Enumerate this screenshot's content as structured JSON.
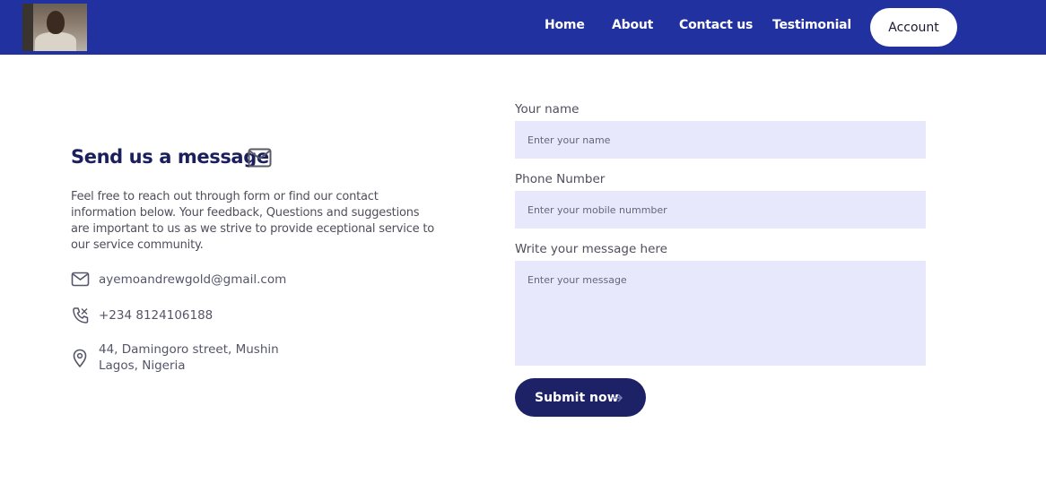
{
  "nav": {
    "links": [
      {
        "label": "Home"
      },
      {
        "label": "About"
      },
      {
        "label": "Contact us"
      },
      {
        "label": "Testimonial"
      }
    ],
    "account_label": "Account"
  },
  "contact": {
    "title": "Send us a message",
    "intro": "Feel free to reach out through form or find our contact information below. Your feedback, Questions and suggestions are important to us as we strive to provide eceptional service to our service community.",
    "email": "ayemoandrewgold@gmail.com",
    "phone": "+234 8124106188",
    "address_line1": "44, Damingoro street, Mushin",
    "address_line2": "Lagos, Nigeria"
  },
  "form": {
    "name_label": "Your name",
    "name_placeholder": "Enter your name",
    "phone_label": "Phone Number",
    "phone_placeholder": "Enter your mobile nummber",
    "message_label": "Write your message here",
    "message_placeholder": "Enter your message",
    "submit_label": "Submit now"
  },
  "icons": {
    "heading": "envelope-icon",
    "email": "envelope-icon",
    "phone": "phone-icon",
    "address": "map-pin-icon",
    "submit": "arrow-right-icon"
  },
  "colors": {
    "navbar": "#2131a0",
    "heading": "#1b1f5e",
    "input_bg": "#e8e8fc",
    "submit_bg": "#1d2266"
  }
}
